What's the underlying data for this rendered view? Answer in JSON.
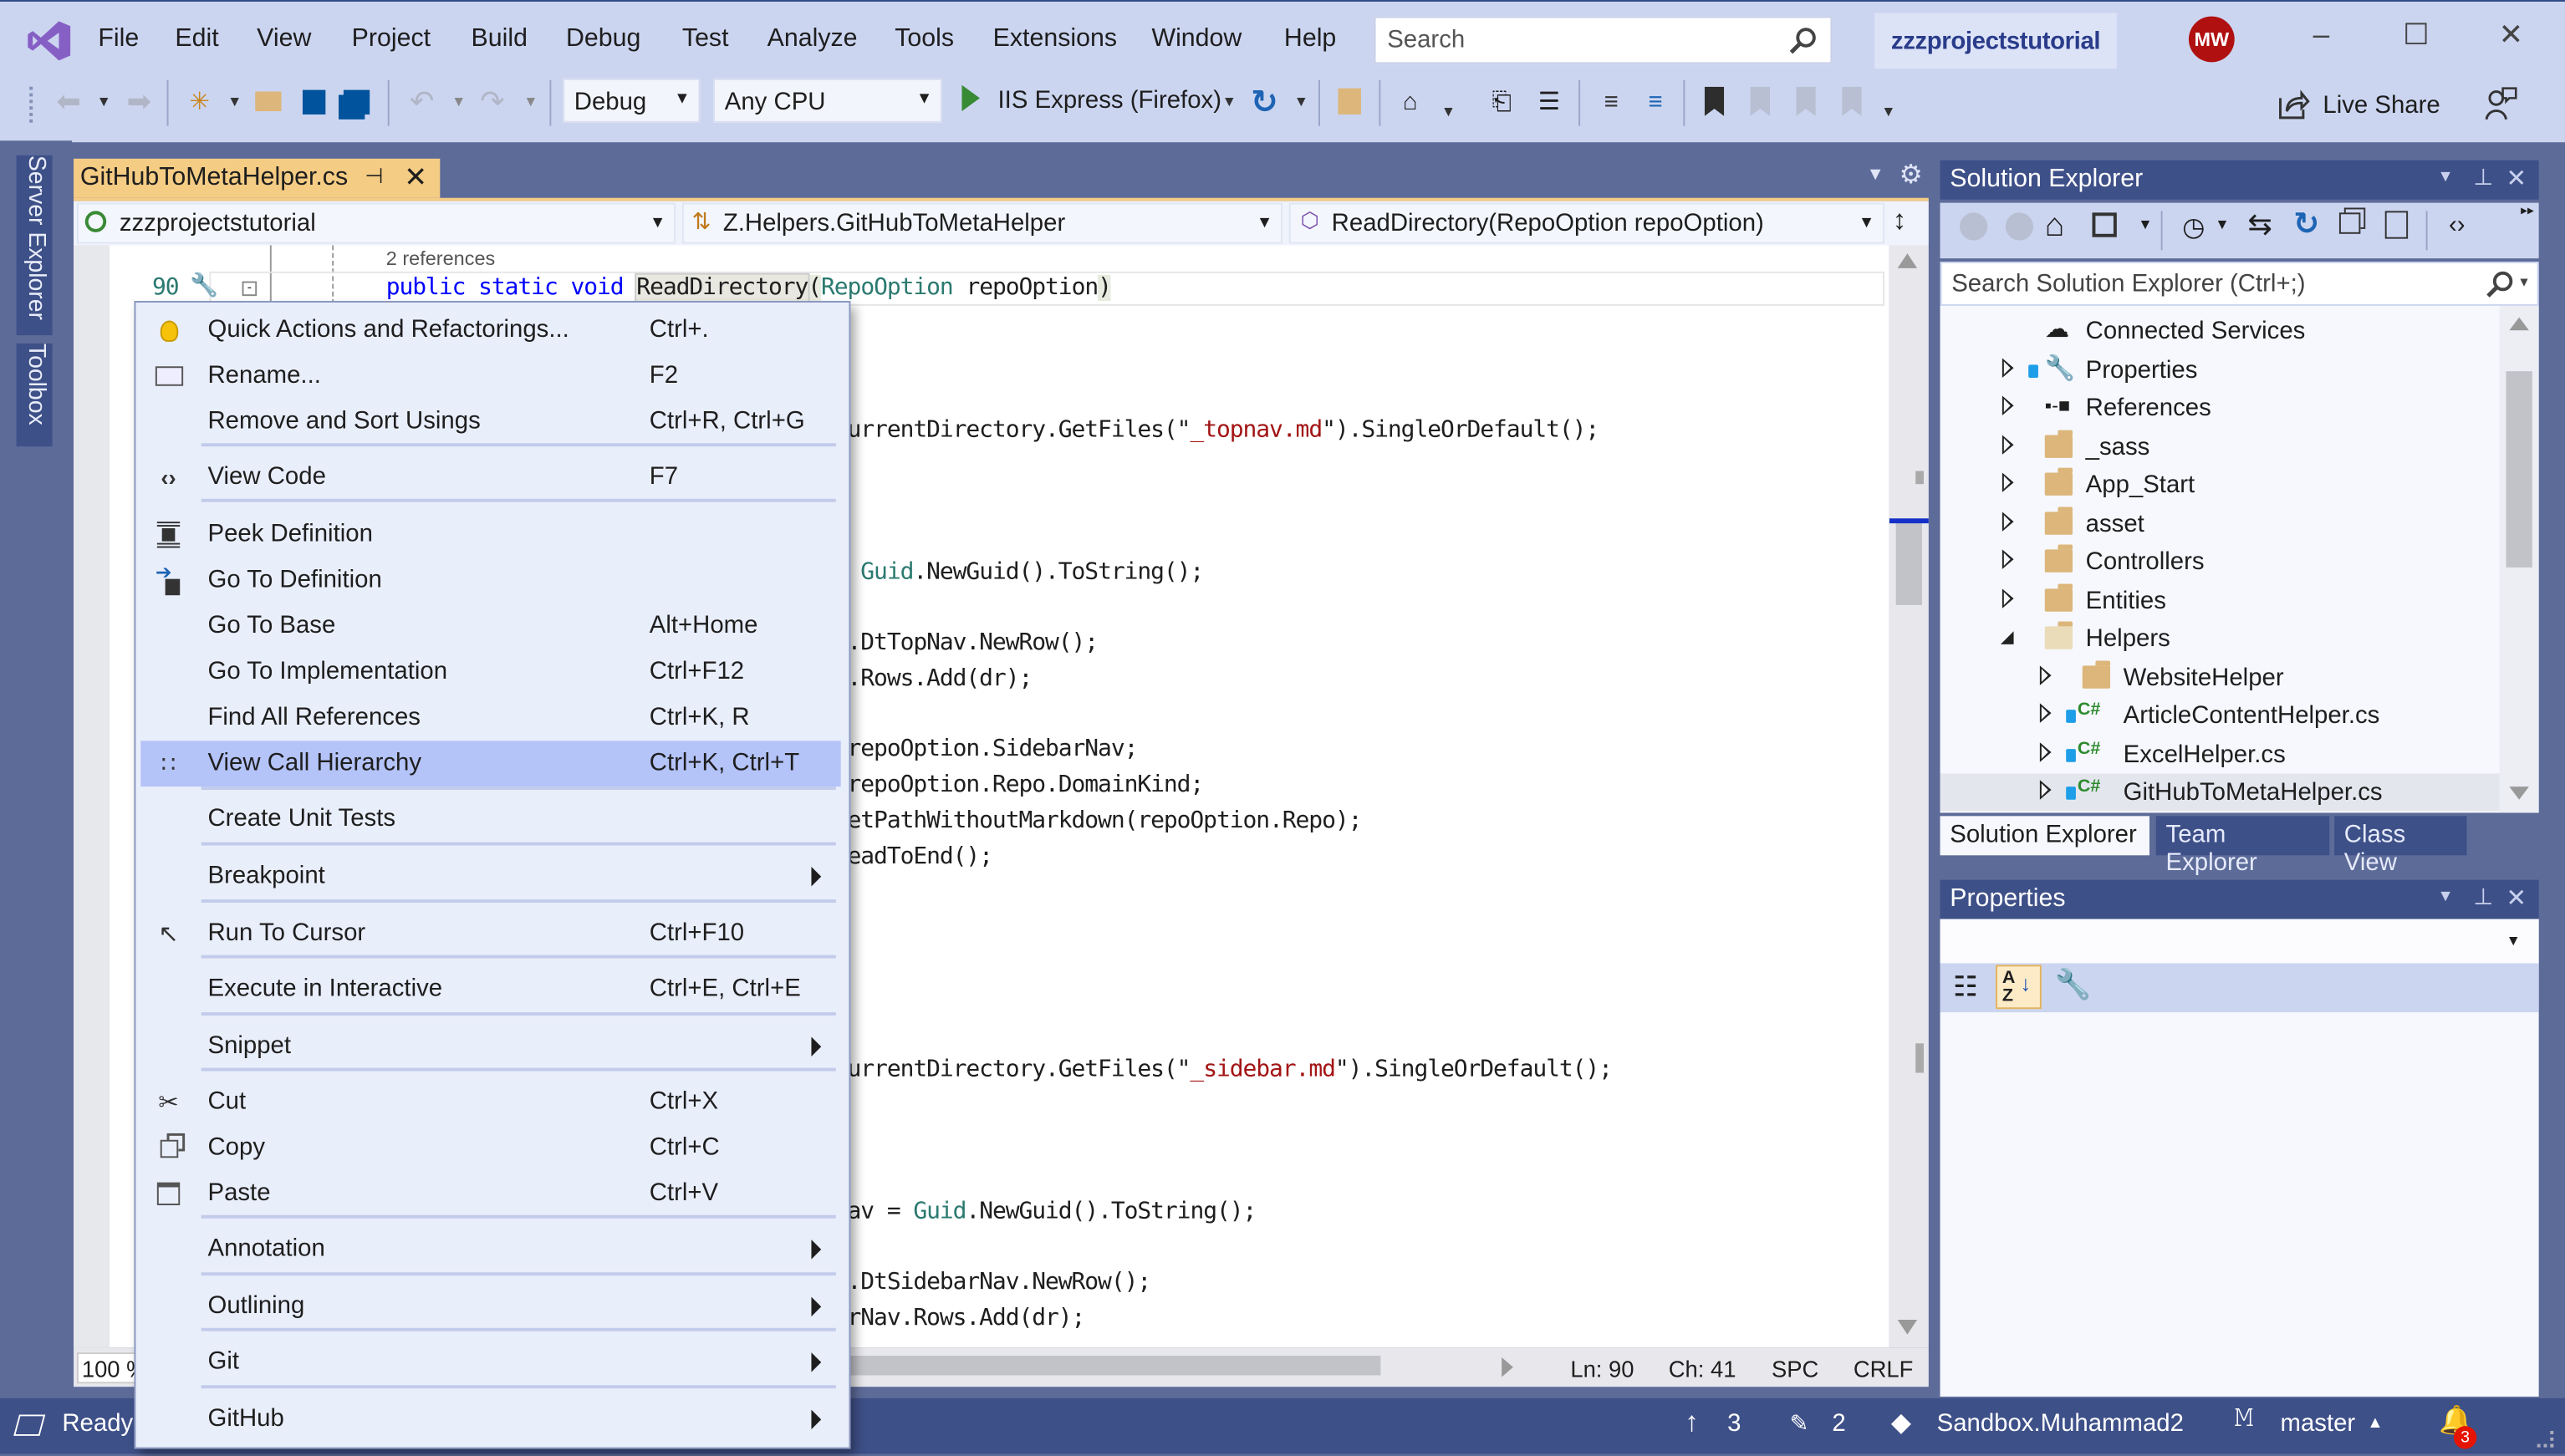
{
  "title_bar": {
    "menu": [
      "File",
      "Edit",
      "View",
      "Project",
      "Build",
      "Debug",
      "Test",
      "Analyze",
      "Tools",
      "Extensions",
      "Window",
      "Help"
    ],
    "search_placeholder": "Search",
    "project_name": "zzzprojectstutorial",
    "avatar_initials": "MW",
    "minimize_glyph": "–",
    "maximize_glyph": "☐",
    "close_glyph": "✕"
  },
  "toolbar": {
    "configuration": "Debug",
    "platform": "Any CPU",
    "run_target": "IIS Express (Firefox)",
    "live_share": "Live Share"
  },
  "left_rail": {
    "tabs": [
      "Server Explorer",
      "Toolbox"
    ]
  },
  "editor": {
    "doc_tab": {
      "title": "GitHubToMetaHelper.cs",
      "pin_glyph": "⊣",
      "close_glyph": "✕"
    },
    "nav": {
      "project": "zzzprojectstutorial",
      "type": "Z.Helpers.GitHubToMetaHelper",
      "member": "ReadDirectory(RepoOption repoOption)"
    },
    "codelens": "2 references",
    "line_number": "90",
    "signature": {
      "kw": "public static void ",
      "method": "ReadDirectory",
      "paren_open": "(",
      "type": "RepoOption",
      "param": " repoOption",
      "paren_close": ")"
    },
    "lines": [
      {
        "pre": "urrentDirectory.GetFiles(\"",
        "str": "_topnav.md",
        "post": "\").SingleOrDefault();"
      },
      {
        "pre": " ",
        "ty": "Guid",
        "post": ".NewGuid().ToString();"
      },
      {
        "pre": ".DtTopNav.NewRow();"
      },
      {
        "pre": ".Rows.Add(dr);"
      },
      {
        "pre": "repoOption.SidebarNav;"
      },
      {
        "pre": "repoOption.Repo.DomainKind;"
      },
      {
        "pre": "etPathWithoutMarkdown(repoOption.Repo);"
      },
      {
        "pre": "eadToEnd();"
      },
      {
        "pre": "urrentDirectory.GetFiles(\"",
        "str": "_sidebar.md",
        "post": "\").SingleOrDefault();"
      },
      {
        "pre": "av = ",
        "ty": "Guid",
        "post": ".NewGuid().ToString();"
      },
      {
        "pre": ".DtSidebarNav.NewRow();"
      },
      {
        "pre": "rNav.Rows.Add(dr);"
      }
    ],
    "zoom_level": "100 %",
    "status": {
      "line": "Ln: 90",
      "col": "Ch: 41",
      "indent": "SPC",
      "eol": "CRLF"
    }
  },
  "context_menu": {
    "items": [
      {
        "label": "Quick Actions and Refactorings...",
        "shortcut": "Ctrl+.",
        "icon": "lightbulb-icon"
      },
      {
        "label": "Rename...",
        "shortcut": "F2",
        "icon": "rename-icon"
      },
      {
        "label": "Remove and Sort Usings",
        "shortcut": "Ctrl+R, Ctrl+G"
      },
      {
        "label": "View Code",
        "shortcut": "F7",
        "icon": "code-icon"
      },
      {
        "label": "Peek Definition",
        "shortcut": "",
        "icon": "peek-definition-icon"
      },
      {
        "label": "Go To Definition",
        "shortcut": "",
        "icon": "go-to-definition-icon"
      },
      {
        "label": "Go To Base",
        "shortcut": "Alt+Home"
      },
      {
        "label": "Go To Implementation",
        "shortcut": "Ctrl+F12"
      },
      {
        "label": "Find All References",
        "shortcut": "Ctrl+K, R"
      },
      {
        "label": "View Call Hierarchy",
        "shortcut": "Ctrl+K, Ctrl+T",
        "icon": "call-hierarchy-icon",
        "highlighted": true
      },
      {
        "label": "Create Unit Tests",
        "shortcut": ""
      },
      {
        "label": "Breakpoint",
        "shortcut": "",
        "submenu": true
      },
      {
        "label": "Run To Cursor",
        "shortcut": "Ctrl+F10",
        "icon": "cursor-icon"
      },
      {
        "label": "Execute in Interactive",
        "shortcut": "Ctrl+E, Ctrl+E"
      },
      {
        "label": "Snippet",
        "shortcut": "",
        "submenu": true
      },
      {
        "label": "Cut",
        "shortcut": "Ctrl+X",
        "icon": "scissors-icon"
      },
      {
        "label": "Copy",
        "shortcut": "Ctrl+C",
        "icon": "copy-icon"
      },
      {
        "label": "Paste",
        "shortcut": "Ctrl+V",
        "icon": "paste-icon"
      },
      {
        "label": "Annotation",
        "shortcut": "",
        "submenu": true
      },
      {
        "label": "Outlining",
        "shortcut": "",
        "submenu": true
      },
      {
        "label": "Git",
        "shortcut": "",
        "submenu": true
      },
      {
        "label": "GitHub",
        "shortcut": "",
        "submenu": true
      }
    ]
  },
  "solution_explorer": {
    "title": "Solution Explorer",
    "search_placeholder": "Search Solution Explorer (Ctrl+;)",
    "tree": [
      {
        "label": "Connected Services",
        "kind": "service",
        "depth": 0,
        "expander": "none"
      },
      {
        "label": "Properties",
        "kind": "wrench",
        "depth": 0,
        "expander": "collapsed",
        "locked": true
      },
      {
        "label": "References",
        "kind": "references",
        "depth": 0,
        "expander": "collapsed"
      },
      {
        "label": "_sass",
        "kind": "folder",
        "depth": 0,
        "expander": "collapsed"
      },
      {
        "label": "App_Start",
        "kind": "folder",
        "depth": 0,
        "expander": "collapsed"
      },
      {
        "label": "asset",
        "kind": "folder",
        "depth": 0,
        "expander": "collapsed"
      },
      {
        "label": "Controllers",
        "kind": "folder",
        "depth": 0,
        "expander": "collapsed"
      },
      {
        "label": "Entities",
        "kind": "folder",
        "depth": 0,
        "expander": "collapsed"
      },
      {
        "label": "Helpers",
        "kind": "folder-open",
        "depth": 0,
        "expander": "expanded"
      },
      {
        "label": "WebsiteHelper",
        "kind": "folder",
        "depth": 1,
        "expander": "collapsed"
      },
      {
        "label": "ArticleContentHelper.cs",
        "kind": "csharp",
        "depth": 1,
        "expander": "collapsed",
        "locked": true
      },
      {
        "label": "ExcelHelper.cs",
        "kind": "csharp",
        "depth": 1,
        "expander": "collapsed",
        "locked": true
      },
      {
        "label": "GitHubToMetaHelper.cs",
        "kind": "csharp",
        "depth": 1,
        "expander": "collapsed",
        "locked": true,
        "selected": true
      }
    ],
    "tabs": [
      "Solution Explorer",
      "Team Explorer",
      "Class View"
    ]
  },
  "properties_panel": {
    "title": "Properties"
  },
  "status_bar": {
    "ready": "Ready",
    "push_count": "3",
    "changes_count": "2",
    "repo": "Sandbox.Muhammad2",
    "branch": "master",
    "notifications": "3"
  },
  "colors": {
    "accent_tab": "#f5cc84",
    "chrome": "#ccd5f0",
    "frame": "#5d6b99",
    "panel_header": "#3e5088",
    "menu_highlight": "#b4c3f8",
    "vs_purple": "#865fc5"
  }
}
